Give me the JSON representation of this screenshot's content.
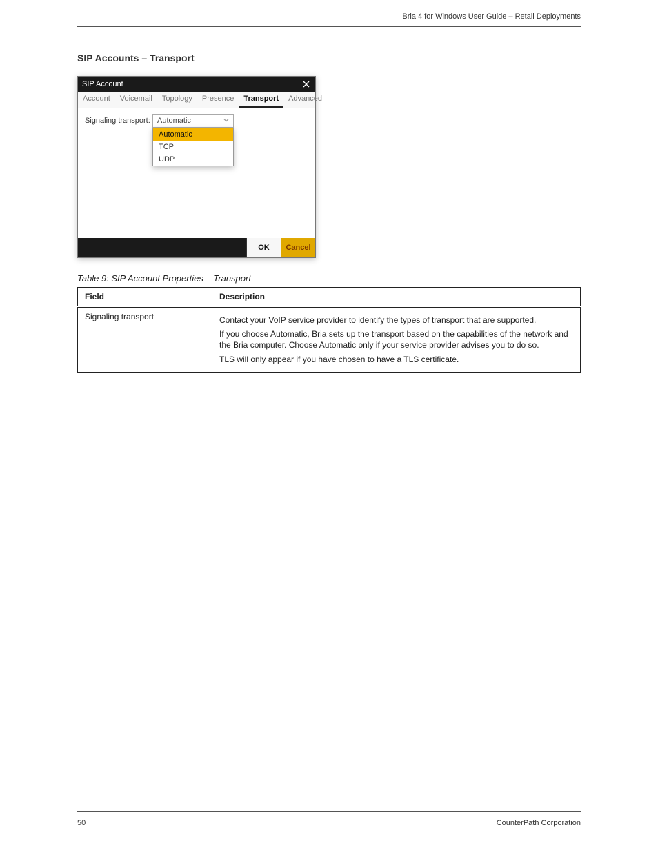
{
  "header": {
    "right": "Bria 4 for Windows User Guide – Retail Deployments"
  },
  "section_heading": "SIP Accounts – Transport",
  "dialog": {
    "title": "SIP Account",
    "tabs": [
      "Account",
      "Voicemail",
      "Topology",
      "Presence",
      "Transport",
      "Advanced"
    ],
    "active_tab_index": 4,
    "field_label": "Signaling transport:",
    "selected_value": "Automatic",
    "options": [
      "Automatic",
      "TCP",
      "UDP"
    ],
    "ok_label": "OK",
    "cancel_label": "Cancel"
  },
  "table": {
    "caption": "Table 9: SIP Account Properties – Transport",
    "headers": [
      "Field",
      "Description"
    ],
    "rows": [
      {
        "field": "Signaling transport",
        "desc": [
          "Contact your VoIP service provider to identify the types of transport that are supported.",
          "If you choose Automatic, Bria sets up the transport based on the capabilities of the network and the Bria computer. Choose Automatic only if your service provider advises you to do so.",
          "TLS will only appear if you have chosen to have a TLS certificate."
        ]
      }
    ]
  },
  "footer": {
    "left": "50",
    "right": "CounterPath Corporation"
  }
}
